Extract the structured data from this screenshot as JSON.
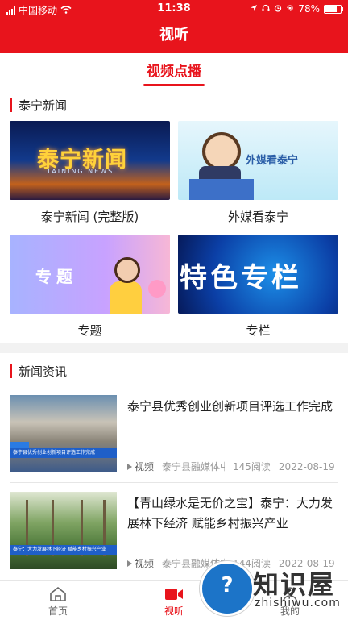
{
  "status_bar": {
    "carrier": "中国移动",
    "time": "11:38",
    "battery": "78%"
  },
  "app_bar": {
    "title": "视听"
  },
  "tabs": [
    {
      "label": "视频点播",
      "active": true
    }
  ],
  "section_video": {
    "title": "泰宁新闻",
    "cards": [
      {
        "label": "泰宁新闻 (完整版)",
        "thumb_text": "泰宁新闻",
        "thumb_subtext": "TAINING NEWS"
      },
      {
        "label": "外媒看泰宁",
        "thumb_text": "外媒看泰宁"
      },
      {
        "label": "专题",
        "thumb_text": "专题"
      },
      {
        "label": "专栏",
        "thumb_text": "特色专栏"
      }
    ]
  },
  "section_news": {
    "title": "新闻资讯",
    "items": [
      {
        "title": "泰宁县优秀创业创新项目评选工作完成",
        "tag": "视频",
        "source": "泰宁县融媒体中心",
        "reads": "145阅读",
        "date": "2022-08-19",
        "thumb_banner": "泰宁县优秀创业创新项目评选工作完成"
      },
      {
        "title": "【青山绿水是无价之宝】泰宁：大力发展林下经济 赋能乡村振兴产业",
        "tag": "视频",
        "source": "泰宁县融媒体中心",
        "reads": "144阅读",
        "date": "2022-08-19",
        "thumb_banner": "泰宁：大力发展林下经济 赋能乡村振兴产业"
      }
    ]
  },
  "bottom_nav": [
    {
      "label": "首页",
      "icon": "home-icon"
    },
    {
      "label": "视听",
      "icon": "video-camera-icon",
      "active": true
    },
    {
      "label": "我的",
      "icon": "user-icon"
    }
  ],
  "watermark": {
    "big": "知识屋",
    "small": "zhishiwu.com"
  },
  "colors": {
    "brand_red": "#e8141c",
    "text": "#222222",
    "muted": "#999999"
  }
}
